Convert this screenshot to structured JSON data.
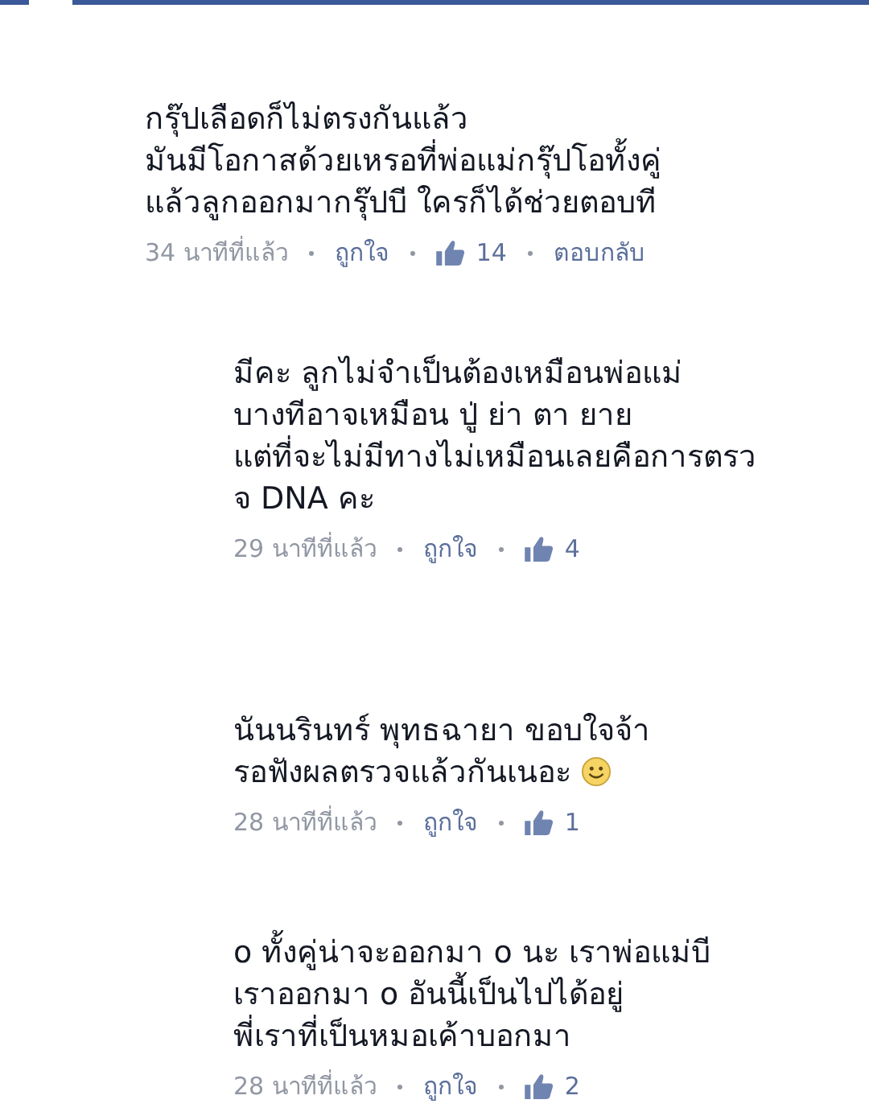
{
  "comments": [
    {
      "text": "กรุ๊ปเลือดก็ไม่ตรงกันแล้ว\nมันมีโอกาสด้วยเหรอที่พ่อแม่กรุ๊ปโอทั้งคู่\nแล้วลูกออกมากรุ๊ปบี ใครก็ได้ช่วยตอบที",
      "smiley": false,
      "time": "34 นาทีที่แล้ว",
      "like": "ถูกใจ",
      "likes": "14",
      "reply": "ตอบกลับ",
      "children": [
        {
          "text": "มีคะ ลูกไม่จำเป็นต้องเหมือนพ่อแม่\nบางทีอาจเหมือน ปู่ ย่า ตา ยาย\nแต่ที่จะไม่มีทางไม่เหมือนเลยคือการตรว\nจ DNA คะ",
          "smiley": false,
          "time": "29 นาทีที่แล้ว",
          "like": "ถูกใจ",
          "likes": "4"
        },
        {
          "text": "นันนรินทร์ พุทธฉายา ขอบใจจ้า\nรอฟังผลตรวจแล้วกันเนอะ",
          "smiley": true,
          "time": "28 นาทีที่แล้ว",
          "like": "ถูกใจ",
          "likes": "1"
        },
        {
          "text": "o ทั้งคู่น่าจะออกมา o นะ เราพ่อแม่บี\nเราออกมา o อันนี้เป็นไปได้อยู่\nพี่เราที่เป็นหมอเค้าบอกมา",
          "smiley": false,
          "time": "28 นาทีที่แล้ว",
          "like": "ถูกใจ",
          "likes": "2"
        }
      ]
    }
  ]
}
